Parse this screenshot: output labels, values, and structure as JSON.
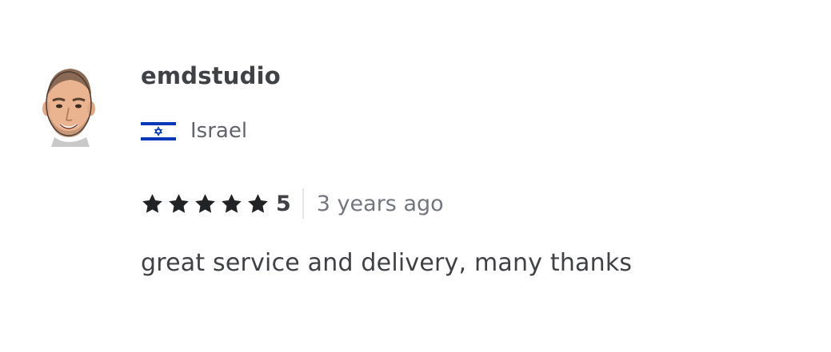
{
  "review": {
    "username": "emdstudio",
    "country": "Israel",
    "rating": {
      "stars": 5,
      "value_label": "5"
    },
    "time_ago": "3 years ago",
    "text": "great service and delivery, many thanks"
  },
  "colors": {
    "text_dark": "#404145",
    "text_muted": "#62646a",
    "star": "#222325",
    "flag_blue": "#0038b8"
  },
  "icons": {
    "avatar": "cartoon-avatar",
    "flag": "israel-flag-icon",
    "star": "star-icon"
  }
}
